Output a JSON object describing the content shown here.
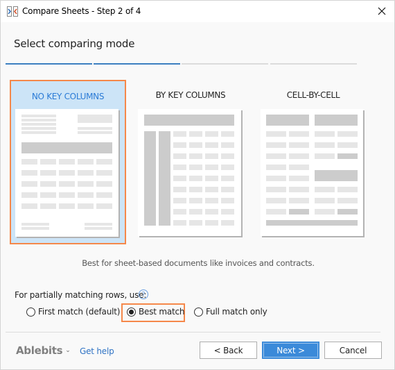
{
  "window": {
    "title": "Compare Sheets - Step 2 of 4",
    "icon": "compare-sheets-icon",
    "close_icon": "close-icon"
  },
  "heading": "Select comparing mode",
  "progress": {
    "current_step": 2,
    "total_steps": 4,
    "active_color": "#3c7fc1",
    "inactive_color": "#dcdcdc"
  },
  "modes": [
    {
      "label": "NO KEY COLUMNS",
      "selected": true
    },
    {
      "label": "BY KEY COLUMNS",
      "selected": false
    },
    {
      "label": "CELL-BY-CELL",
      "selected": false
    }
  ],
  "description": "Best for sheet-based documents like invoices and contracts.",
  "partial": {
    "label": "For partially matching rows, use:",
    "help_icon": "?",
    "options": [
      {
        "label": "First match (default)",
        "checked": false
      },
      {
        "label": "Best match",
        "checked": true
      },
      {
        "label": "Full match only",
        "checked": false
      }
    ]
  },
  "footer": {
    "brand": "Ablebits",
    "brand_chevron": "⌄",
    "help_link": "Get help",
    "back": "< Back",
    "next": "Next >",
    "cancel": "Cancel"
  },
  "colors": {
    "highlight": "#f5884a",
    "selected_bg": "#cce4f7",
    "primary_button": "#3b8ad9",
    "link": "#2f73c4"
  }
}
